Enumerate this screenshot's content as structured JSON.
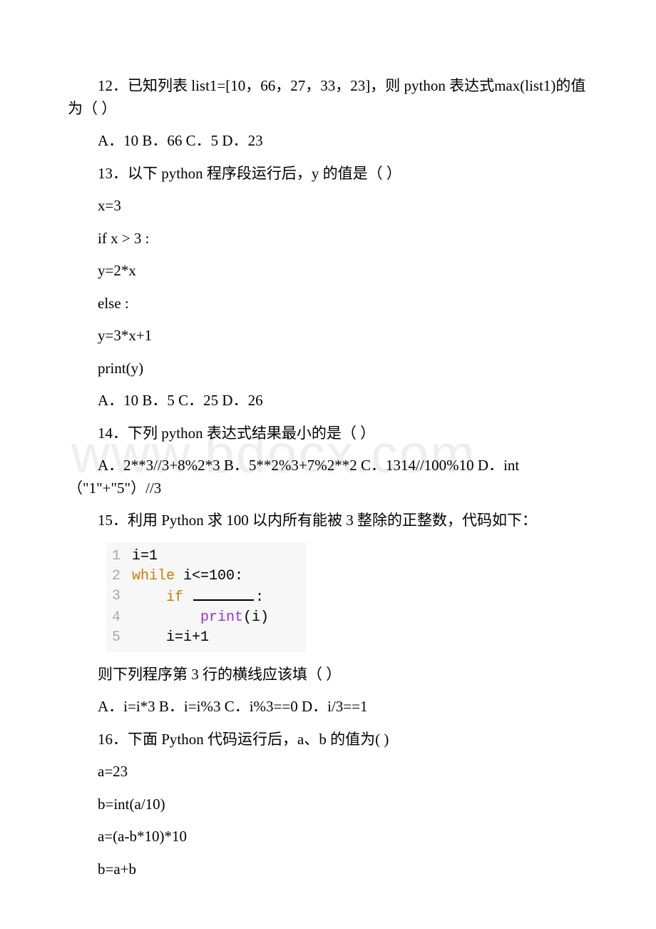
{
  "watermark": "www.bdocx.com",
  "q12": {
    "text": "12．已知列表 list1=[10，66，27，33，23]，则 python 表达式max(list1)的值为（ ）",
    "options": "A．10 B．66 C．5 D．23"
  },
  "q13": {
    "text": "13．以下 python 程序段运行后，y 的值是（ ）",
    "code": {
      "l1": "x=3",
      "l2": "if x > 3 :",
      "l3": " y=2*x",
      "l4": "else :",
      "l5": " y=3*x+1",
      "l6": "print(y)"
    },
    "options": "A．10 B．5 C．25 D．26"
  },
  "q14": {
    "text": "14．下列 python 表达式结果最小的是（ ）",
    "options": "A．2**3//3+8%2*3 B．5**2%3+7%2**2 C．1314//100%10 D．int（\"1\"+\"5\"）//3"
  },
  "q15": {
    "text": "15．利用 Python 求 100 以内所有能被 3 整除的正整数，代码如下：",
    "code": {
      "l1": "i=1",
      "l2_pre": "while",
      "l2_rest": " i<=100:",
      "l3_pre": "    if",
      "l3_rest": " ",
      "l3_colon": ":",
      "l4_pre": "        ",
      "l4_print": "print",
      "l4_rest": "(i)",
      "l5": "    i=i+1"
    },
    "follow": "则下列程序第 3 行的横线应该填（ ）",
    "options": "A．i=i*3 B．i=i%3 C．i%3==0 D．i/3==1"
  },
  "q16": {
    "text": "16．下面 Python 代码运行后，a、b 的值为( )",
    "code": {
      "l1": "a=23",
      "l2": "b=int(a/10)",
      "l3": "a=(a-b*10)*10",
      "l4": "b=a+b"
    }
  }
}
